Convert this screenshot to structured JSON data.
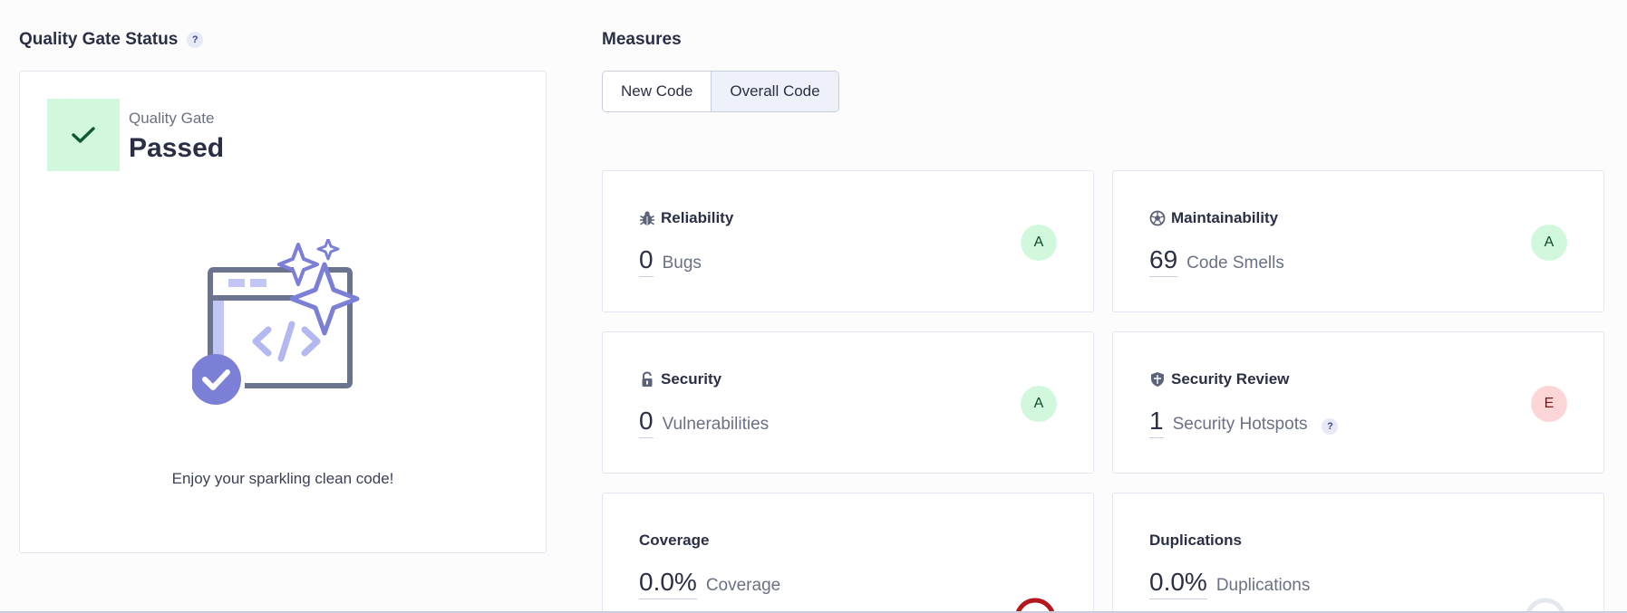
{
  "quality_gate": {
    "title": "Quality Gate Status",
    "help": "?",
    "label": "Quality Gate",
    "status": "Passed",
    "message": "Enjoy your sparkling clean code!"
  },
  "measures": {
    "title": "Measures",
    "tabs": [
      {
        "label": "New Code",
        "active": false
      },
      {
        "label": "Overall Code",
        "active": true
      }
    ],
    "cards": [
      {
        "name": "Reliability",
        "value": "0",
        "unit": "Bugs",
        "rating": "A",
        "icon": "bug-icon"
      },
      {
        "name": "Maintainability",
        "value": "69",
        "unit": "Code Smells",
        "rating": "A",
        "icon": "soccer-ball-icon"
      },
      {
        "name": "Security",
        "value": "0",
        "unit": "Vulnerabilities",
        "rating": "A",
        "icon": "lock-icon"
      },
      {
        "name": "Security Review",
        "value": "1",
        "unit": "Security Hotspots",
        "help": "?",
        "rating": "E",
        "icon": "shield-icon"
      },
      {
        "name": "Coverage",
        "value": "0.0%",
        "unit": "Coverage"
      },
      {
        "name": "Duplications",
        "value": "0.0%",
        "unit": "Duplications"
      }
    ]
  },
  "colors": {
    "pass_bg": "#d1f7dd",
    "pass_fg": "#0d7a3a",
    "rating_a_bg": "#d1f7dd",
    "rating_e_bg": "#fcd6d6",
    "accent": "#7b80d6"
  }
}
